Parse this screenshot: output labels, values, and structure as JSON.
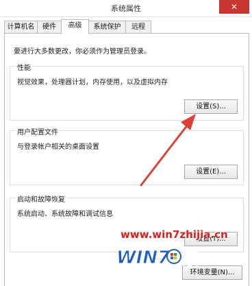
{
  "window": {
    "title": "系统属性",
    "close_glyph": "✕"
  },
  "tabs": [
    {
      "label": "计算机名",
      "active": false
    },
    {
      "label": "硬件",
      "active": false
    },
    {
      "label": "高级",
      "active": true
    },
    {
      "label": "系统保护",
      "active": false
    },
    {
      "label": "远程",
      "active": false
    }
  ],
  "panel": {
    "notice": "要进行大多数更改，你必须作为管理员登录。",
    "performance": {
      "title": "性能",
      "description": "视觉效果，处理器计划，内存使用，以及虚拟内存",
      "button": "设置(S)..."
    },
    "user_profiles": {
      "title": "用户配置文件",
      "description": "与登录帐户相关的桌面设置",
      "button": "设置(E)..."
    },
    "startup_recovery": {
      "title": "启动和故障恢复",
      "description": "系统启动、系统故障和调试信息",
      "button": "设置(T)..."
    },
    "env_button": "环境变量(N)..."
  },
  "watermark": {
    "site": "www.win7zhijia.cn",
    "logo_prefix": "WIN7",
    "logo_suffix": "家"
  },
  "colors": {
    "arrow": "#d9413a",
    "close": "#c7372f",
    "watermark": "#d62020",
    "logo_blue": "#1f5fc4"
  }
}
